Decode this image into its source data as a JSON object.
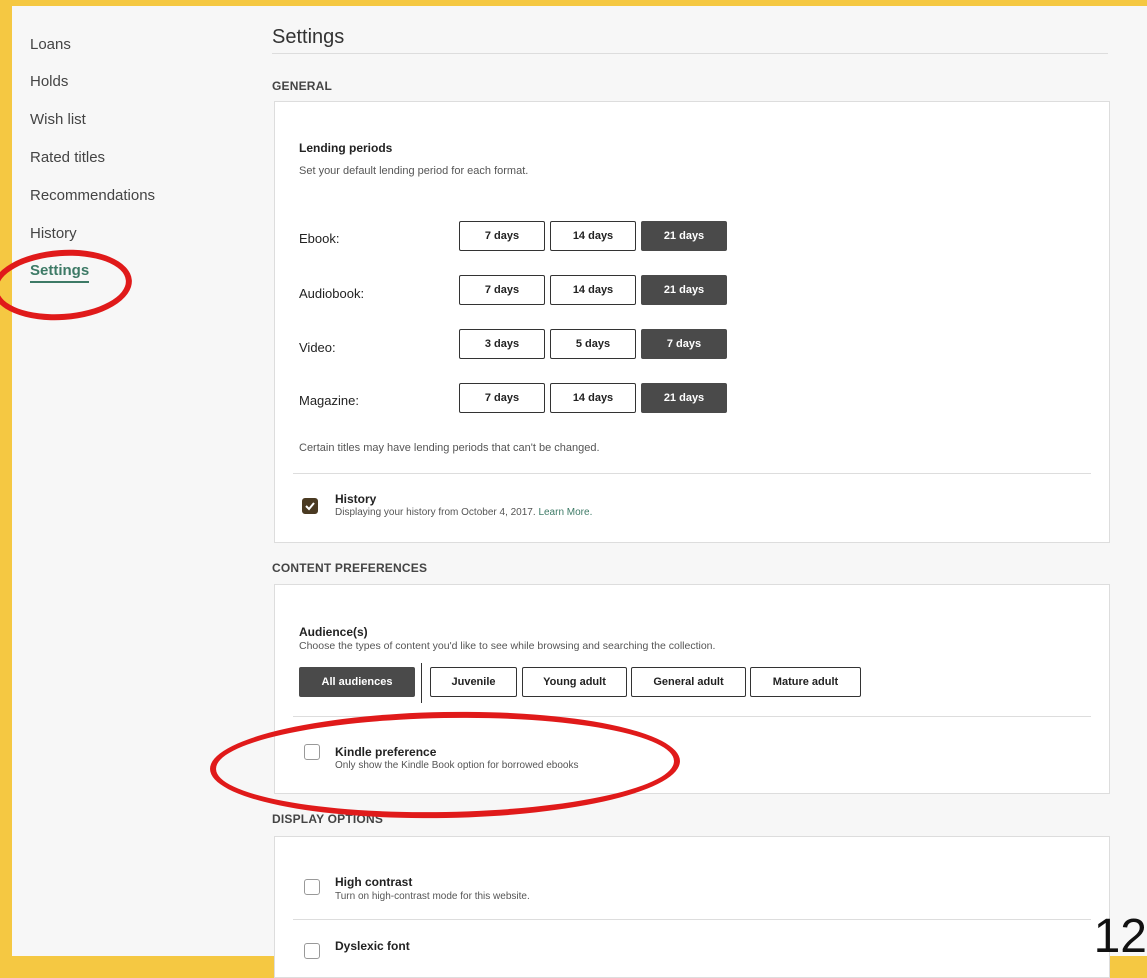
{
  "sidebar": {
    "items": [
      {
        "label": "Loans"
      },
      {
        "label": "Holds"
      },
      {
        "label": "Wish list"
      },
      {
        "label": "Rated titles"
      },
      {
        "label": "Recommendations"
      },
      {
        "label": "History"
      },
      {
        "label": "Settings",
        "active": true
      }
    ]
  },
  "page": {
    "title": "Settings"
  },
  "general": {
    "heading": "GENERAL",
    "lending": {
      "title": "Lending periods",
      "subtitle": "Set your default lending period for each format.",
      "formats": [
        {
          "label": "Ebook:",
          "options": [
            "7 days",
            "14 days",
            "21 days"
          ],
          "selected": "21 days"
        },
        {
          "label": "Audiobook:",
          "options": [
            "7 days",
            "14 days",
            "21 days"
          ],
          "selected": "21 days"
        },
        {
          "label": "Video:",
          "options": [
            "3 days",
            "5 days",
            "7 days"
          ],
          "selected": "7 days"
        },
        {
          "label": "Magazine:",
          "options": [
            "7 days",
            "14 days",
            "21 days"
          ],
          "selected": "21 days"
        }
      ],
      "note": "Certain titles may have lending periods that can't be changed."
    },
    "history": {
      "title": "History",
      "description": "Displaying your history from October 4, 2017.",
      "link": "Learn More.",
      "checked": true
    }
  },
  "content_preferences": {
    "heading": "CONTENT PREFERENCES",
    "audiences": {
      "title": "Audience(s)",
      "description": "Choose the types of content you'd like to see while browsing and searching the collection.",
      "options": [
        "All audiences",
        "Juvenile",
        "Young adult",
        "General adult",
        "Mature adult"
      ],
      "selected": "All audiences"
    },
    "kindle": {
      "title": "Kindle preference",
      "description": "Only show the Kindle Book option for borrowed ebooks",
      "checked": false
    }
  },
  "display_options": {
    "heading": "DISPLAY OPTIONS",
    "high_contrast": {
      "title": "High contrast",
      "description": "Turn on high-contrast mode for this website.",
      "checked": false
    },
    "dyslexic_font": {
      "title": "Dyslexic font",
      "checked": false
    }
  },
  "slide_number": "12",
  "colors": {
    "background": "#f5c842",
    "accent": "#3d7a66",
    "selected_button": "#4a4a4a",
    "annotation": "#e01a1a"
  }
}
